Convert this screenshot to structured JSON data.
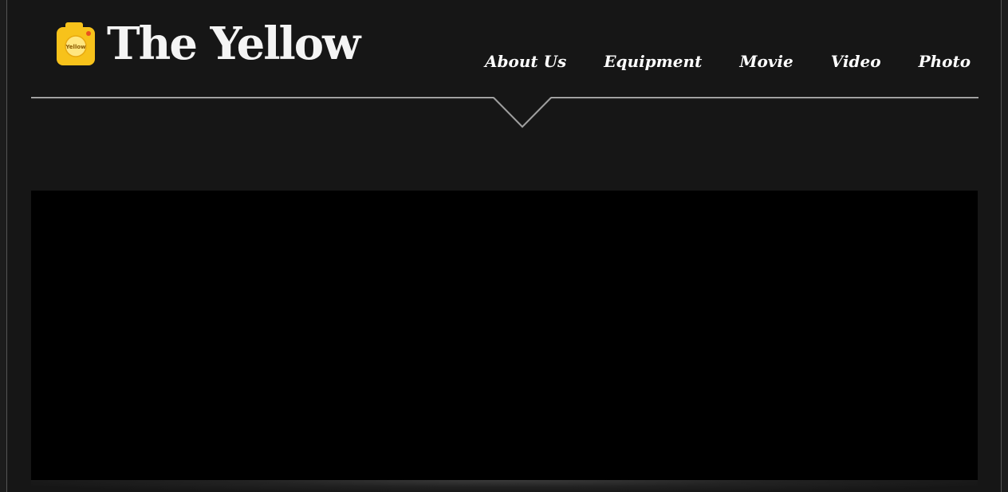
{
  "site": {
    "title": "The Yellow",
    "logo_badge": "Yellow",
    "brand_color": "#f7c21b",
    "accent_dot_color": "#e8521f",
    "background_color": "#161616"
  },
  "nav": {
    "items": [
      {
        "label": "About Us"
      },
      {
        "label": "Equipment"
      },
      {
        "label": "Movie"
      },
      {
        "label": "Video"
      },
      {
        "label": "Photo"
      }
    ],
    "active_indicator": "chevron-down-icon"
  },
  "main": {
    "video_player": {
      "state": "blank"
    }
  }
}
